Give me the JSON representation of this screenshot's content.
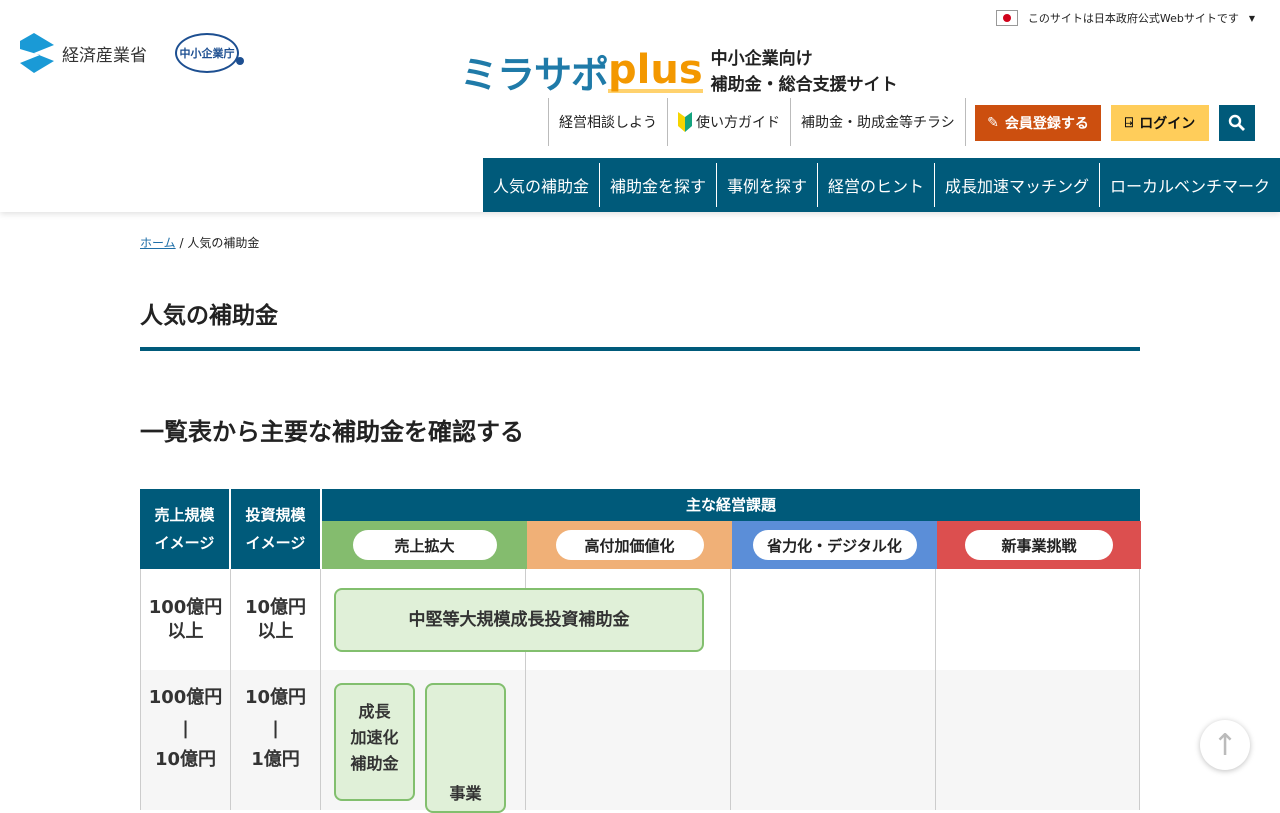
{
  "header": {
    "gov_notice": "このサイトは日本政府公式Webサイトです",
    "meti_logo": "経済産業省",
    "sme_logo": "中小企業庁",
    "brand_main": "ミラサポ",
    "brand_plus": "plus",
    "brand_sub1": "中小企業向け",
    "brand_sub2": "補助金・総合支援サイト",
    "util_links": [
      "経営相談しよう",
      "使い方ガイド",
      "補助金・助成金等チラシ"
    ],
    "register": "会員登録する",
    "login": "ログイン"
  },
  "nav": [
    "人気の補助金",
    "補助金を探す",
    "事例を探す",
    "経営のヒント",
    "成長加速マッチング",
    "ローカルベンチマーク"
  ],
  "breadcrumb": {
    "home": "ホーム",
    "sep": "/",
    "current": "人気の補助金"
  },
  "page_title": "人気の補助金",
  "section_title": "一覧表から主要な補助金を確認する",
  "table": {
    "col_sales": "売上規模イメージ",
    "col_invest": "投資規模イメージ",
    "issues_title": "主な経営課題",
    "issues": [
      {
        "label": "売上拡大",
        "color": "#84bc6e"
      },
      {
        "label": "高付加価値化",
        "color": "#f0b077"
      },
      {
        "label": "省力化・デジタル化",
        "color": "#5b8ed8"
      },
      {
        "label": "新事業挑戦",
        "color": "#dc4f4f"
      }
    ],
    "rows": [
      {
        "sales": "100億円\n以上",
        "invest": "10億円\n以上"
      },
      {
        "sales": "100億円\n|\n10億円",
        "invest": "10億円\n|\n1億円"
      }
    ],
    "grants": [
      "中堅等大規模成長投資補助金",
      "成長\n加速化\n補助金",
      "事業"
    ]
  }
}
